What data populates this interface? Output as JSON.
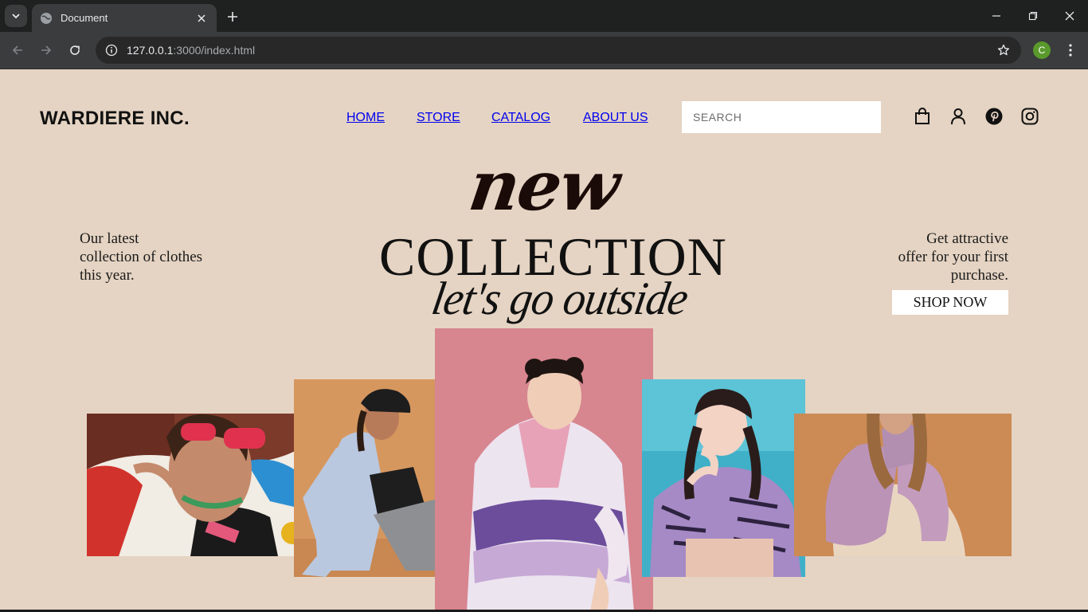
{
  "browser": {
    "tab_title": "Document",
    "url_host": "127.0.0.1",
    "url_rest": ":3000/index.html",
    "profile_initial": "C"
  },
  "header": {
    "logo": "WARDIERE INC.",
    "nav": [
      "HOME",
      "STORE",
      "CATALOG",
      "ABOUT US"
    ],
    "search_placeholder": "SEARCH",
    "icons": [
      "shopping-bag-icon",
      "user-icon",
      "pinterest-icon",
      "instagram-icon"
    ]
  },
  "hero": {
    "new": "new",
    "collection": "COLLECTION",
    "tagline": "let's go outside",
    "left_text": [
      "Our latest",
      "collection of clothes",
      "this year."
    ],
    "right_text": [
      "Get attractive",
      "offer for your first",
      "purchase."
    ],
    "cta": "SHOP NOW"
  },
  "photos": [
    {
      "label": "model-sunglasses-sweater-photo",
      "bg": "#7a3c2c"
    },
    {
      "label": "model-cap-shirt-photo",
      "bg": "#d99a66"
    },
    {
      "label": "model-tracksuit-jacket-photo",
      "bg": "#d98796"
    },
    {
      "label": "model-purple-top-photo",
      "bg": "#47b1c7"
    },
    {
      "label": "model-fur-sleeves-photo",
      "bg": "#c98a55"
    }
  ],
  "colors": {
    "page_bg": "#e5d4c3",
    "text": "#111111",
    "search_bg": "#ffffff"
  }
}
